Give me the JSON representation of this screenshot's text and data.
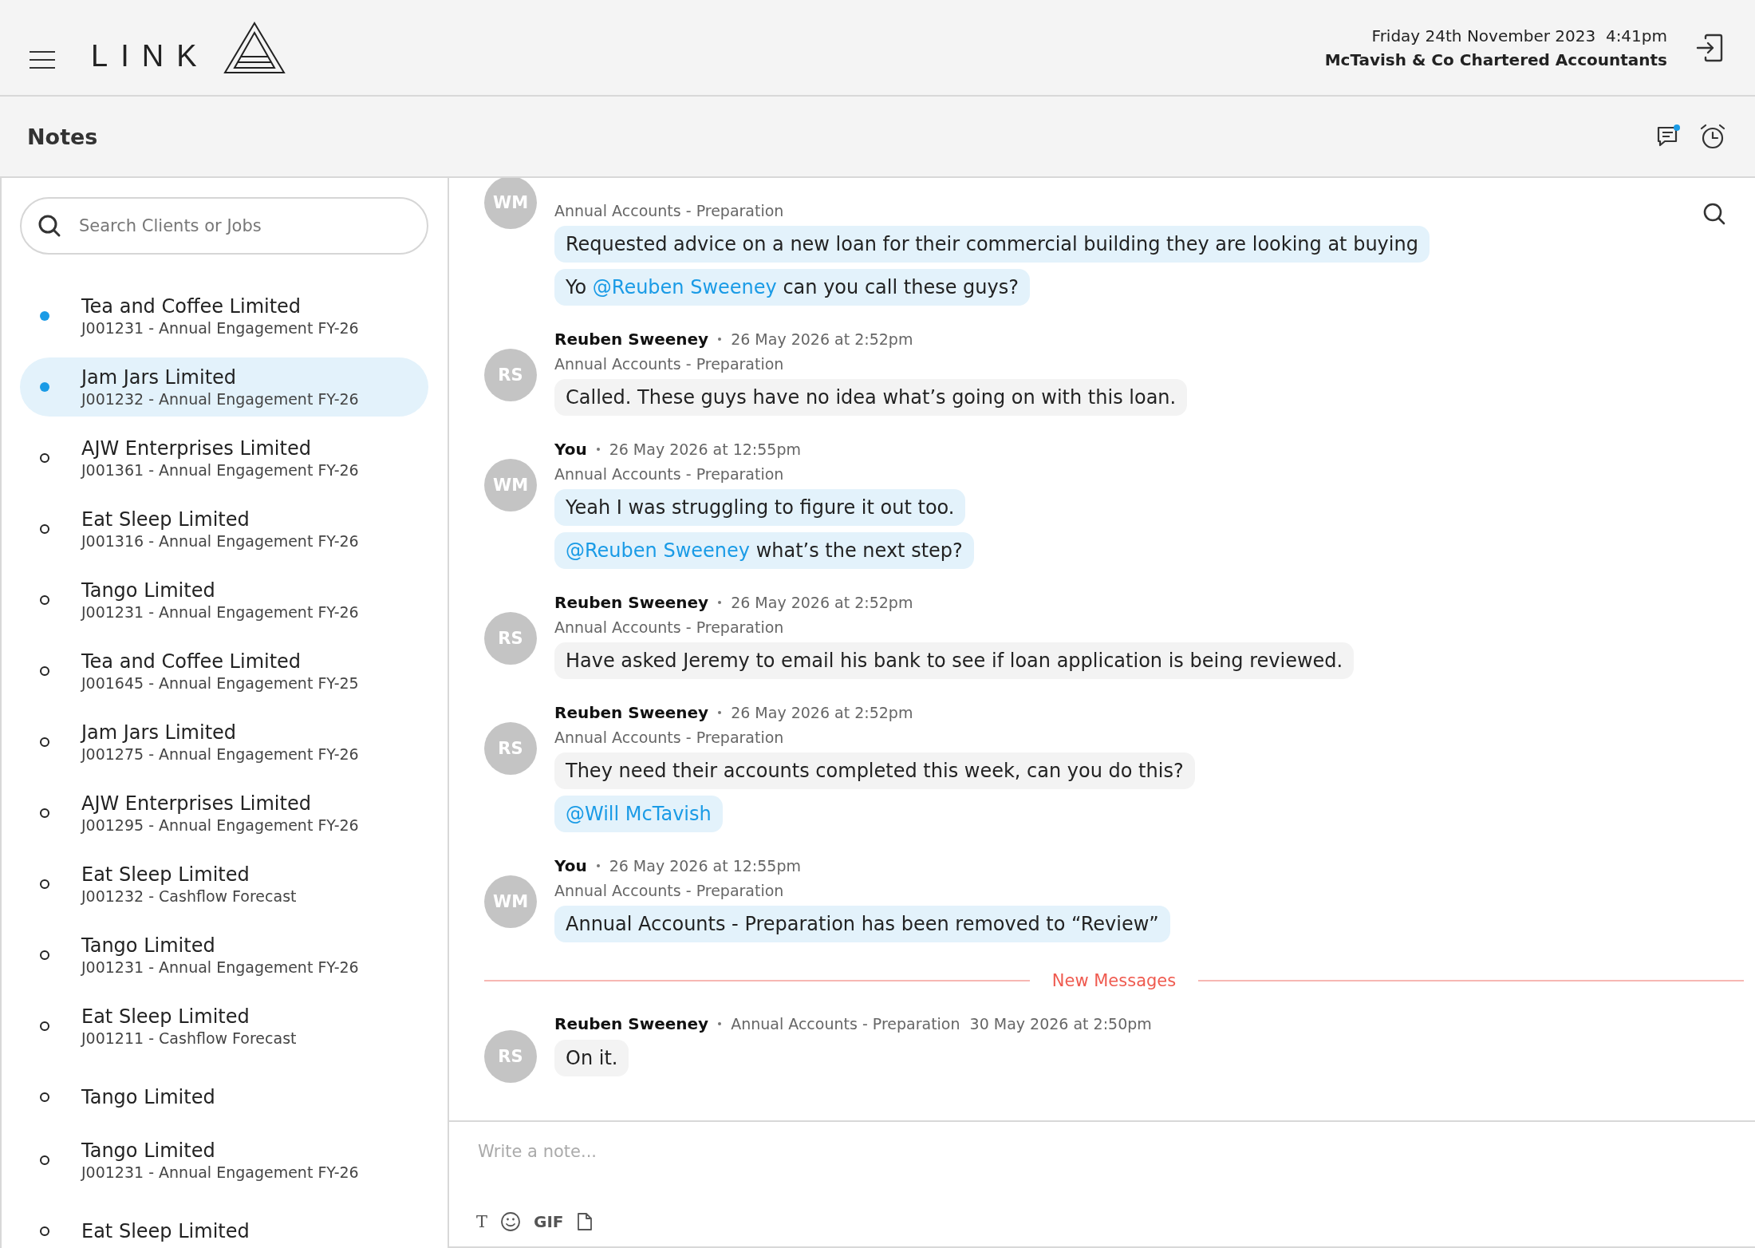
{
  "header": {
    "logo": "LINK",
    "date_time": "Friday 24th November 2023  4:41pm",
    "firm": "McTavish & Co Chartered Accountants"
  },
  "page_title": "Notes",
  "chat_unread": true,
  "sidebar": {
    "search": {
      "placeholder": "Search Clients or Jobs"
    },
    "items": [
      {
        "name": "Tea and Coffee Limited",
        "job": "J001231 - Annual Engagement FY-26",
        "unread": true,
        "selected": false
      },
      {
        "name": "Jam Jars Limited",
        "job": "J001232 - Annual Engagement FY-26",
        "unread": true,
        "selected": true
      },
      {
        "name": "AJW Enterprises Limited",
        "job": "J001361 - Annual Engagement FY-26",
        "unread": false,
        "selected": false
      },
      {
        "name": "Eat Sleep Limited",
        "job": "J001316 - Annual Engagement FY-26",
        "unread": false,
        "selected": false
      },
      {
        "name": "Tango Limited",
        "job": "J001231 - Annual Engagement FY-26",
        "unread": false,
        "selected": false
      },
      {
        "name": "Tea and Coffee Limited",
        "job": "J001645 - Annual Engagement FY-25",
        "unread": false,
        "selected": false
      },
      {
        "name": "Jam Jars Limited",
        "job": "J001275 - Annual Engagement FY-26",
        "unread": false,
        "selected": false
      },
      {
        "name": "AJW Enterprises Limited",
        "job": "J001295 - Annual Engagement FY-26",
        "unread": false,
        "selected": false
      },
      {
        "name": "Eat Sleep Limited",
        "job": "J001232 - Cashflow Forecast",
        "unread": false,
        "selected": false
      },
      {
        "name": "Tango Limited",
        "job": "J001231 - Annual Engagement FY-26",
        "unread": false,
        "selected": false
      },
      {
        "name": "Eat Sleep Limited",
        "job": "J001211 - Cashflow Forecast",
        "unread": false,
        "selected": false
      },
      {
        "name": "Tango Limited",
        "unread": false,
        "selected": false
      },
      {
        "name": "Tango Limited",
        "job": "J001231 - Annual Engagement FY-26",
        "unread": false,
        "selected": false
      },
      {
        "name": "Eat Sleep Limited",
        "unread": false,
        "selected": false
      }
    ]
  },
  "messages": [
    {
      "kind": "message",
      "avatar": "WM",
      "job": "Annual Accounts - Preparation",
      "bubbles": [
        {
          "highlighted": true,
          "parts": [
            {
              "kind": "text",
              "text": "Requested advice on a new loan for their commercial building they are looking at buying"
            }
          ]
        },
        {
          "highlighted": true,
          "parts": [
            {
              "kind": "text",
              "text": "Yo "
            },
            {
              "kind": "mention",
              "text": "@Reuben Sweeney"
            },
            {
              "kind": "text",
              "text": " can you call these guys?"
            }
          ]
        }
      ]
    },
    {
      "kind": "message",
      "avatar": "RS",
      "author": "Reuben Sweeney",
      "time": "26 May 2026 at 2:52pm",
      "job": "Annual Accounts - Preparation",
      "bubbles": [
        {
          "highlighted": false,
          "parts": [
            {
              "kind": "text",
              "text": "Called. These guys have no idea what’s going on with this loan."
            }
          ]
        }
      ]
    },
    {
      "kind": "message",
      "avatar": "WM",
      "author": "You",
      "time": "26 May 2026 at 12:55pm",
      "job": "Annual Accounts - Preparation",
      "bubbles": [
        {
          "highlighted": true,
          "parts": [
            {
              "kind": "text",
              "text": "Yeah I was struggling to figure it out too."
            }
          ]
        },
        {
          "highlighted": true,
          "parts": [
            {
              "kind": "mention",
              "text": "@Reuben Sweeney"
            },
            {
              "kind": "text",
              "text": " what’s the next step?"
            }
          ]
        }
      ]
    },
    {
      "kind": "message",
      "avatar": "RS",
      "author": "Reuben Sweeney",
      "time": "26 May 2026 at 2:52pm",
      "job": "Annual Accounts - Preparation",
      "bubbles": [
        {
          "highlighted": false,
          "parts": [
            {
              "kind": "text",
              "text": "Have asked Jeremy to email his bank to see if loan application is being reviewed."
            }
          ]
        }
      ]
    },
    {
      "kind": "message",
      "avatar": "RS",
      "author": "Reuben Sweeney",
      "time": "26 May 2026 at 2:52pm",
      "job": "Annual Accounts - Preparation",
      "bubbles": [
        {
          "highlighted": false,
          "parts": [
            {
              "kind": "text",
              "text": "They need their accounts completed this week, can you do this?"
            }
          ]
        },
        {
          "highlighted": true,
          "parts": [
            {
              "kind": "mention",
              "text": "@Will McTavish"
            }
          ]
        }
      ]
    },
    {
      "kind": "message",
      "avatar": "WM",
      "author": "You",
      "time": "26 May 2026 at 12:55pm",
      "job": "Annual Accounts - Preparation",
      "bubbles": [
        {
          "highlighted": true,
          "parts": [
            {
              "kind": "text",
              "text": "Annual Accounts - Preparation has been removed to “Review”"
            }
          ]
        }
      ]
    },
    {
      "kind": "divider",
      "label": "New Messages"
    },
    {
      "kind": "message",
      "meta_inline": true,
      "avatar": "RS",
      "author": "Reuben Sweeney",
      "time": "30 May 2026 at 2:50pm",
      "job": "Annual Accounts - Preparation",
      "bubbles": [
        {
          "highlighted": false,
          "parts": [
            {
              "kind": "text",
              "text": "On it."
            }
          ]
        }
      ]
    }
  ],
  "composer": {
    "placeholder": "Write a note...",
    "tools": [
      {
        "kind": "text",
        "label": "T"
      },
      {
        "kind": "emoji"
      },
      {
        "kind": "gif",
        "label": "GIF"
      },
      {
        "kind": "file"
      }
    ]
  }
}
